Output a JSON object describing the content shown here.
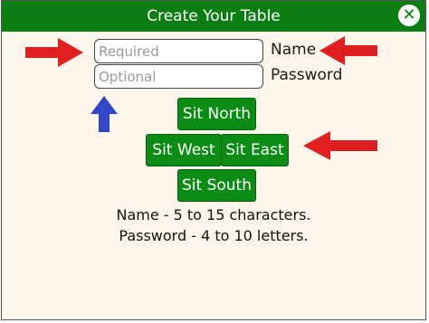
{
  "dialog": {
    "title": "Create Your Table",
    "close_icon": "close-icon"
  },
  "form": {
    "name_placeholder": "Required",
    "name_label": "Name",
    "password_placeholder": "Optional",
    "password_label": "Password"
  },
  "seats": {
    "north": "Sit North",
    "west": "Sit West",
    "east": "Sit East",
    "south": "Sit South"
  },
  "info": {
    "name_rule": "Name - 5 to 15 characters.",
    "password_rule": "Password - 4 to 10 letters."
  },
  "annotations": {
    "arrow_color_red": "#e02020",
    "arrow_color_blue": "#3547c9"
  },
  "colors": {
    "titlebar": "#0b7d12",
    "button": "#0b8c14",
    "background": "#fdf6ec"
  }
}
